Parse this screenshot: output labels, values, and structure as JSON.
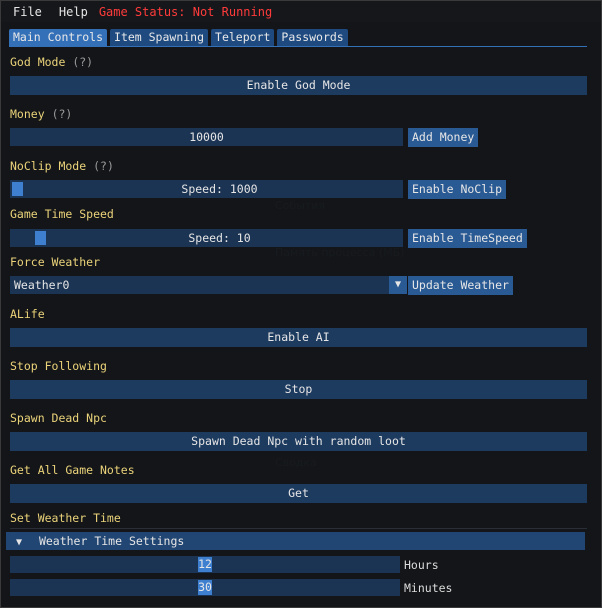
{
  "menu": {
    "file": "File",
    "help": "Help",
    "status": "Game Status: Not Running"
  },
  "tabs": [
    {
      "label": "Main Controls",
      "active": true
    },
    {
      "label": "Item Spawning",
      "active": false
    },
    {
      "label": "Teleport",
      "active": false
    },
    {
      "label": "Passwords",
      "active": false
    }
  ],
  "help_marker": "(?)",
  "god_mode": {
    "label": "God Mode",
    "button": "Enable God Mode"
  },
  "money": {
    "label": "Money",
    "value": "10000",
    "button": "Add Money"
  },
  "noclip": {
    "label": "NoClip Mode",
    "slider_text": "Speed: 1000",
    "level": 0,
    "button": "Enable NoClip"
  },
  "time_speed": {
    "label": "Game Time Speed",
    "slider_text": "Speed: 10",
    "level": 0.06,
    "button": "Enable TimeSpeed"
  },
  "weather": {
    "label": "Force Weather",
    "selected": "Weather0",
    "button": "Update Weather",
    "arrow": "▼"
  },
  "alife": {
    "label": "ALife",
    "button": "Enable AI"
  },
  "stop_following": {
    "label": "Stop Following",
    "button": "Stop"
  },
  "spawn_dead": {
    "label": "Spawn Dead Npc",
    "button": "Spawn Dead Npc with random loot"
  },
  "notes": {
    "label": "Get All Game Notes",
    "button": "Get"
  },
  "weather_time": {
    "label": "Set Weather Time",
    "header": "Weather Time Settings",
    "header_arrow": "▼",
    "hours": {
      "value": "12",
      "unit": "Hours",
      "level": 0.5
    },
    "minutes": {
      "value": "30",
      "unit": "Minutes",
      "level": 0.5
    }
  }
}
